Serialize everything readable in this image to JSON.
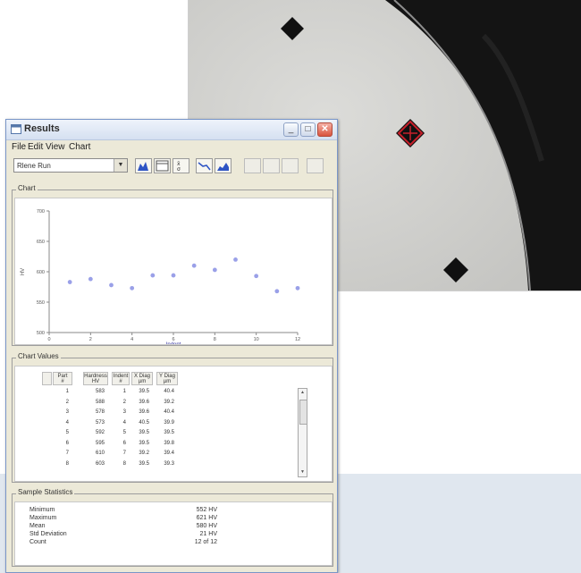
{
  "window": {
    "title": "Results"
  },
  "menu": [
    "File",
    "Edit",
    "View",
    "Chart"
  ],
  "toolbar": {
    "combo_value": "Rlene Run"
  },
  "chart_panel": {
    "legend": "Chart"
  },
  "chart_data": {
    "type": "scatter",
    "title": "",
    "xlabel": "Indent",
    "ylabel": "HV",
    "xlim": [
      0,
      12
    ],
    "ylim": [
      500,
      700
    ],
    "xticks": [
      "0",
      "2",
      "4",
      "6",
      "8",
      "10",
      "12"
    ],
    "yticks": [
      "700",
      "650",
      "600",
      "550",
      "500"
    ],
    "x": [
      1,
      2,
      3,
      4,
      5,
      6,
      7,
      8,
      9,
      10,
      11,
      12
    ],
    "y": [
      583,
      588,
      578,
      573,
      594,
      594,
      610,
      603,
      620,
      593,
      568,
      573
    ],
    "color": "#9aa0e8",
    "grid": false
  },
  "values_panel": {
    "legend": "Chart Values",
    "columns": [
      "Part\n#",
      "Hardness\nHV",
      "Indent\n#",
      "X Diag\nµm",
      "Y Diag\nµm"
    ],
    "rows": [
      [
        "1",
        "583",
        "1",
        "39.5",
        "40.4"
      ],
      [
        "2",
        "588",
        "2",
        "39.6",
        "39.2"
      ],
      [
        "3",
        "578",
        "3",
        "39.6",
        "40.4"
      ],
      [
        "4",
        "573",
        "4",
        "40.5",
        "39.9"
      ],
      [
        "5",
        "592",
        "5",
        "39.5",
        "39.5"
      ],
      [
        "6",
        "595",
        "6",
        "39.5",
        "39.8"
      ],
      [
        "7",
        "610",
        "7",
        "39.2",
        "39.4"
      ],
      [
        "8",
        "603",
        "8",
        "39.5",
        "39.3"
      ]
    ]
  },
  "stats_panel": {
    "legend": "Sample Statistics",
    "rows": [
      {
        "label": "Minimum",
        "value": "552 HV"
      },
      {
        "label": "Maximum",
        "value": "621 HV"
      },
      {
        "label": "Mean",
        "value": "580 HV"
      },
      {
        "label": "Std Deviation",
        "value": "21 HV"
      },
      {
        "label": "Count",
        "value": "12 of 12"
      }
    ]
  },
  "colors": {
    "accent": "#7a96c8",
    "window_bg": "#ece9d8",
    "indent_marker": "#c8202a"
  }
}
